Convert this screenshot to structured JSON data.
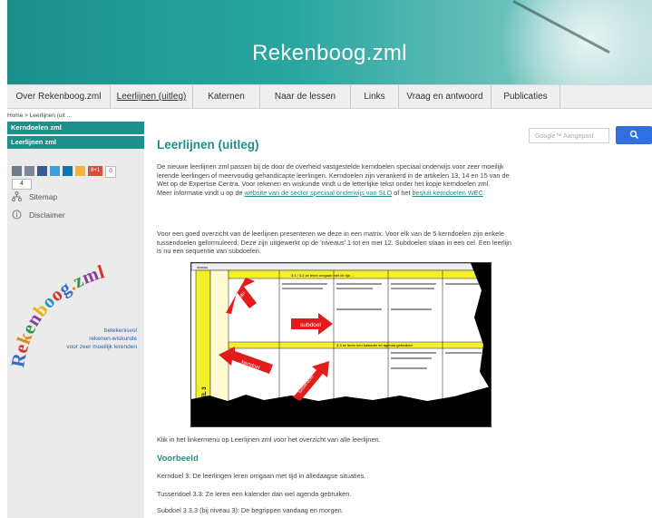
{
  "site": {
    "title": "Rekenboog.zml"
  },
  "nav": [
    {
      "label": "Over Rekenboog.zml",
      "width": 114
    },
    {
      "label": "Leerlijnen (uitleg)",
      "width": 91,
      "active": true
    },
    {
      "label": "Katernen",
      "width": 74
    },
    {
      "label": "Naar de lessen",
      "width": 100
    },
    {
      "label": "Links",
      "width": 53
    },
    {
      "label": "Vraag en antwoord",
      "width": 102
    },
    {
      "label": "Publicaties",
      "width": 76
    }
  ],
  "breadcrumb": "Home  >  Leerlijnen (uit ...",
  "sidebar": {
    "links": [
      "Kerndoelen zml",
      "Leerlijnen zml"
    ],
    "share_count": "4",
    "share_plus": "8+1",
    "share_zero": "0",
    "sitemap": "Sitemap",
    "disclaimer": "Disclaimer",
    "logo_word": "Rekenboog.zml",
    "tagline": [
      "betekenisvol",
      "rekenen-wiskunde",
      "voor zeer moeilijk lerenden"
    ]
  },
  "search": {
    "placeholder": "Google™ Aangepast",
    "button": "🔍"
  },
  "content": {
    "title": "Leerlijnen (uitleg)",
    "para1": "De nieuwe leerlijnen zml passen bij de door de overheid vastgestelde kerndoelen speciaal onderwijs voor zeer moeilijk lerende leerlingen of meervoudig gehandicapte leerlingen. Kerndoelen zijn verankerd in de artikelen 13, 14 en 15 van de Wet op de Expertise Centra. Voor rekenen en wiskunde vindt u de letterlijke tekst onder het kopje kerndoelen zml.",
    "para1b_pre": "Meer informatie vindt u op de ",
    "para1b_link1": "website van de sector speciaal onderwijs van SLO",
    "para1b_mid": " of het ",
    "para1b_link2": "besluit kerndoelen WEC",
    "para1b_end": ".",
    "para2": "Voor een goed overzicht van de leerlijnen presenteren we deze in een matrix. Voor elk van de 5 kerndoelen zijn enkele tussendoelen geformuleerd. Deze zijn uitgewerkt op de 'niveaus' 1 tot en met 12. Subdoelen staan in een cel. Een leerlijn is nu een sequentie van subdoelen.",
    "matrix_labels": {
      "niveau": "niveau",
      "subdoel": "subdoel",
      "kerndoel": "kerndoel",
      "tussendoel": "tussendoel",
      "side": "KERNDOEL 3",
      "h31": "3.1 / 3.2 ze leren omgaan met de tijd ...",
      "h33": "3.3 ze leren een kalender en agenda gebruiken"
    },
    "para3": "Klik in het linkermenu op Leerlijnen zml voor het overzicht van alle leerlijnen.",
    "example_title": "Voorbeeld",
    "example_lines": [
      "Kerndoel 3: De leerlingen leren omgaan met tijd in alledaagse situaties.",
      "Tussendoel 3.3: Ze leren een kalender dan wel agenda gebruiken.",
      "Subdoel 3.3.3 (bij niveau 3): De begrippen vandaag en morgen."
    ]
  }
}
